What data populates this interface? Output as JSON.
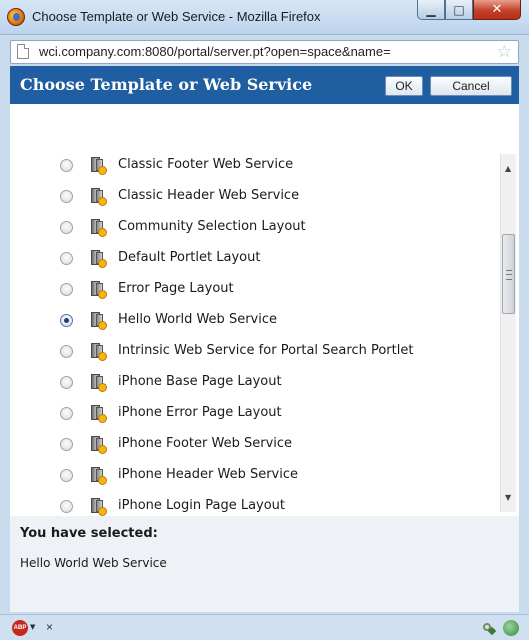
{
  "window": {
    "title": "Choose Template or Web Service - Mozilla Firefox",
    "minimize_glyph": "▁",
    "maximize_glyph": "□",
    "close_glyph": "✕"
  },
  "urlbar": {
    "url": "wci.company.com:8080/portal/server.pt?open=space&name=",
    "star_glyph": "☆"
  },
  "dialog": {
    "title": "Choose Template or Web Service",
    "ok_label": "OK",
    "cancel_label": "Cancel"
  },
  "list": {
    "items": [
      {
        "label": "Classic Footer Web Service",
        "selected": false
      },
      {
        "label": "Classic Header Web Service",
        "selected": false
      },
      {
        "label": "Community Selection Layout",
        "selected": false
      },
      {
        "label": "Default Portlet Layout",
        "selected": false
      },
      {
        "label": "Error Page Layout",
        "selected": false
      },
      {
        "label": "Hello World Web Service",
        "selected": true
      },
      {
        "label": "Intrinsic Web Service for Portal Search Portlet",
        "selected": false
      },
      {
        "label": "iPhone Base Page Layout",
        "selected": false
      },
      {
        "label": "iPhone Error Page Layout",
        "selected": false
      },
      {
        "label": "iPhone Footer Web Service",
        "selected": false
      },
      {
        "label": "iPhone Header Web Service",
        "selected": false
      },
      {
        "label": "iPhone Login Page Layout",
        "selected": false
      }
    ]
  },
  "selection": {
    "heading": "You have selected:",
    "value": "Hello World Web Service"
  },
  "statusbar": {
    "abp_label": "ABP",
    "close_glyph": "×"
  },
  "colors": {
    "dialog_header": "#1f5ea1",
    "selected_panel": "#eef2f7"
  }
}
